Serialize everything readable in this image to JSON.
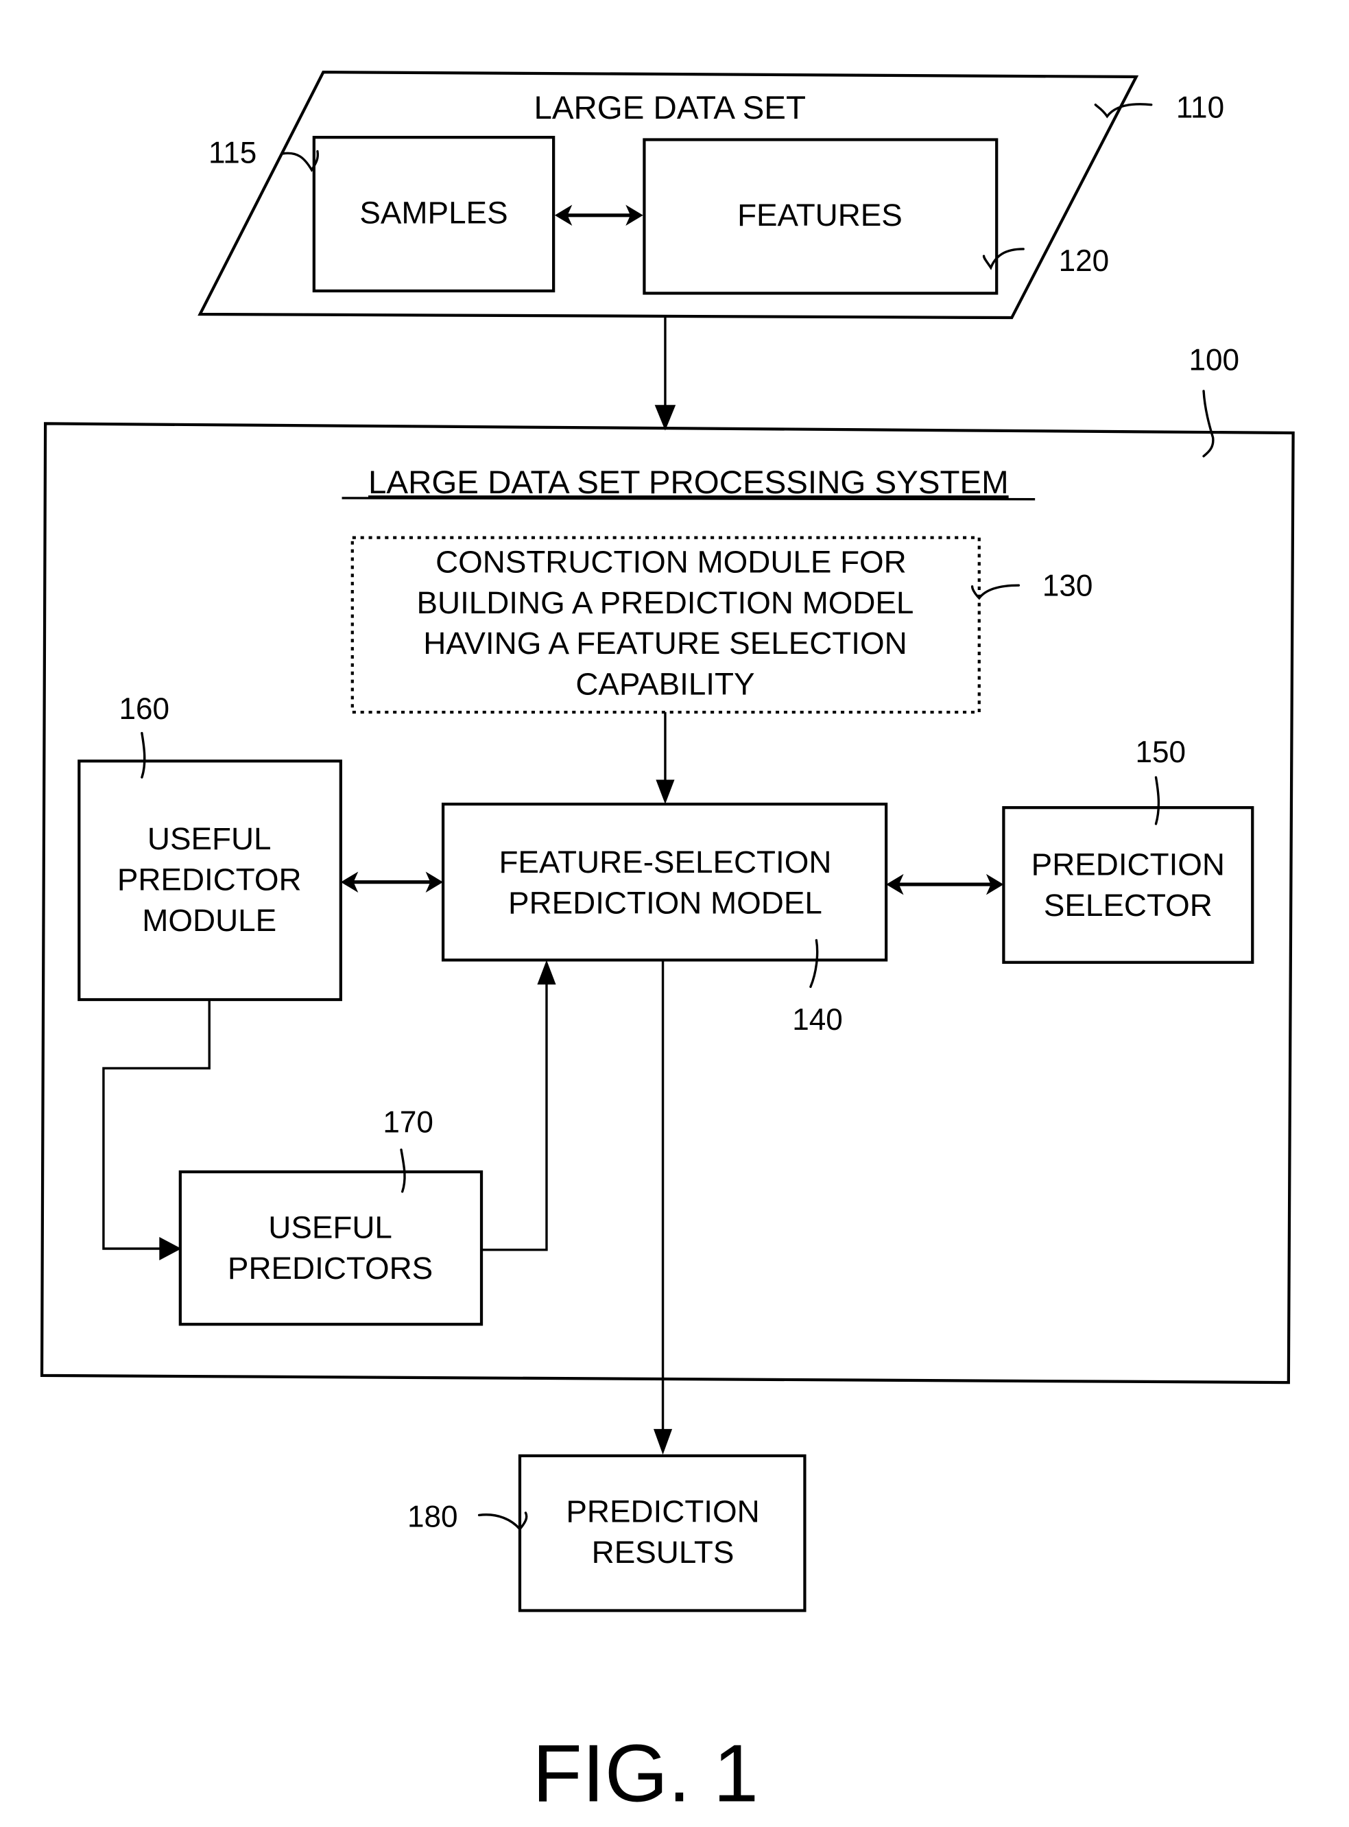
{
  "figure_label": "FIG. 1",
  "data_set": {
    "title": "LARGE DATA SET",
    "ref": "110",
    "samples": {
      "label": "SAMPLES",
      "ref": "115"
    },
    "features": {
      "label": "FEATURES",
      "ref": "120"
    }
  },
  "system": {
    "title": "LARGE DATA SET PROCESSING SYSTEM",
    "ref": "100",
    "construction_module": {
      "lines": [
        "CONSTRUCTION MODULE FOR",
        "BUILDING A PREDICTION MODEL",
        "HAVING A FEATURE SELECTION",
        "CAPABILITY"
      ],
      "ref": "130"
    },
    "prediction_model": {
      "lines": [
        "FEATURE-SELECTION",
        "PREDICTION MODEL"
      ],
      "ref": "140"
    },
    "prediction_selector": {
      "lines": [
        "PREDICTION",
        "SELECTOR"
      ],
      "ref": "150"
    },
    "useful_predictor_module": {
      "lines": [
        "USEFUL",
        "PREDICTOR",
        "MODULE"
      ],
      "ref": "160"
    },
    "useful_predictors": {
      "lines": [
        "USEFUL",
        "PREDICTORS"
      ],
      "ref": "170"
    }
  },
  "results": {
    "lines": [
      "PREDICTION",
      "RESULTS"
    ],
    "ref": "180"
  }
}
